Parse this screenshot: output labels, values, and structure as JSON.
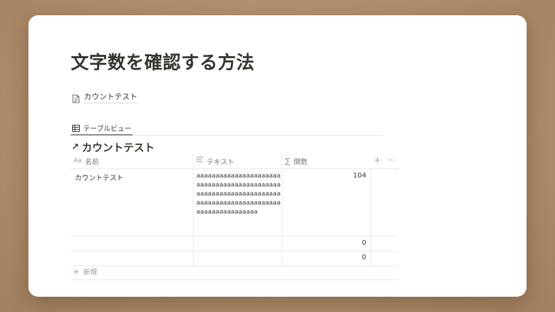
{
  "page": {
    "title": "文字数を確認する方法",
    "link_label": "カウントテスト"
  },
  "view": {
    "tab_label": "テーブルビュー"
  },
  "database": {
    "title": "カウントテスト",
    "columns": [
      {
        "label": "名前",
        "icon": "title-aa-icon"
      },
      {
        "label": "テキスト",
        "icon": "text-lines-icon"
      },
      {
        "label": "関数",
        "icon": "sigma-icon"
      }
    ],
    "add_column_label": "+",
    "more_label": "···",
    "rows": [
      {
        "name": "カウントテスト",
        "text": "aaaaaaaaaaaaaaaaaaaaaaaaaaaaaaaaaaaaaaaaaaaaaaaaaaaaaaaaaaaaaaaaaaaaaaaaaaaaaaaaaaaaaaaaaaaaaaaaaaaaaaaa",
        "count": "104"
      },
      {
        "name": "",
        "text": "",
        "count": "0"
      },
      {
        "name": "",
        "text": "",
        "count": "0"
      }
    ],
    "new_row_label": "新規"
  }
}
